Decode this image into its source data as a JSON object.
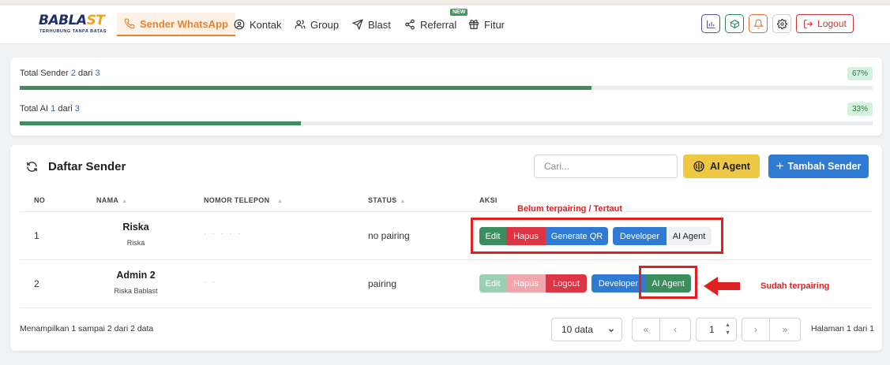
{
  "brand": {
    "name_part1": "BABLA",
    "name_part2": "ST",
    "tagline": "TERHUBUNG TANPA BATAS"
  },
  "nav": {
    "items": [
      {
        "label": "Sender WhatsApp",
        "icon": "phone-icon",
        "active": true
      },
      {
        "label": "Kontak",
        "icon": "user-circle-icon"
      },
      {
        "label": "Group",
        "icon": "users-icon"
      },
      {
        "label": "Blast",
        "icon": "send-icon"
      },
      {
        "label": "Referral",
        "icon": "share-icon",
        "badge": "NEW"
      },
      {
        "label": "Fitur",
        "icon": "gift-icon"
      }
    ],
    "logout_label": "Logout"
  },
  "usage": {
    "sender": {
      "label_prefix": "Total Sender",
      "used": "2",
      "separator": "dari",
      "total": "3",
      "percent_label": "67%",
      "fraction": 0.67
    },
    "ai": {
      "label_prefix": "Total AI",
      "used": "1",
      "separator": "dari",
      "total": "3",
      "percent_label": "33%",
      "fraction": 0.33
    }
  },
  "sender_list": {
    "title": "Daftar Sender",
    "search_placeholder": "Cari...",
    "ai_agent_button": "AI Agent",
    "add_button": "Tambah Sender",
    "columns": [
      "NO",
      "NAMA",
      "NOMOR TELEPON",
      "STATUS",
      "AKSI"
    ],
    "rows": [
      {
        "no": "1",
        "name": "Riska",
        "subname": "Riska",
        "status": "no pairing",
        "actions": [
          "Edit",
          "Hapus",
          "Generate QR",
          "Developer",
          "AI Agent"
        ]
      },
      {
        "no": "2",
        "name": "Admin 2",
        "subname": "Riska Bablast",
        "status": "pairing",
        "actions": [
          "Edit",
          "Hapus",
          "Logout",
          "Developer",
          "AI Agent"
        ]
      }
    ],
    "footer_summary": "Menampilkan 1 sampai 2 dari 2 data",
    "page_size": "10 data",
    "current_page": "1",
    "page_info": "Halaman 1 dari 1"
  },
  "annotations": {
    "unpaired_note": "Belum terpairing / Tertaut",
    "paired_note": "Sudah terpairing"
  }
}
